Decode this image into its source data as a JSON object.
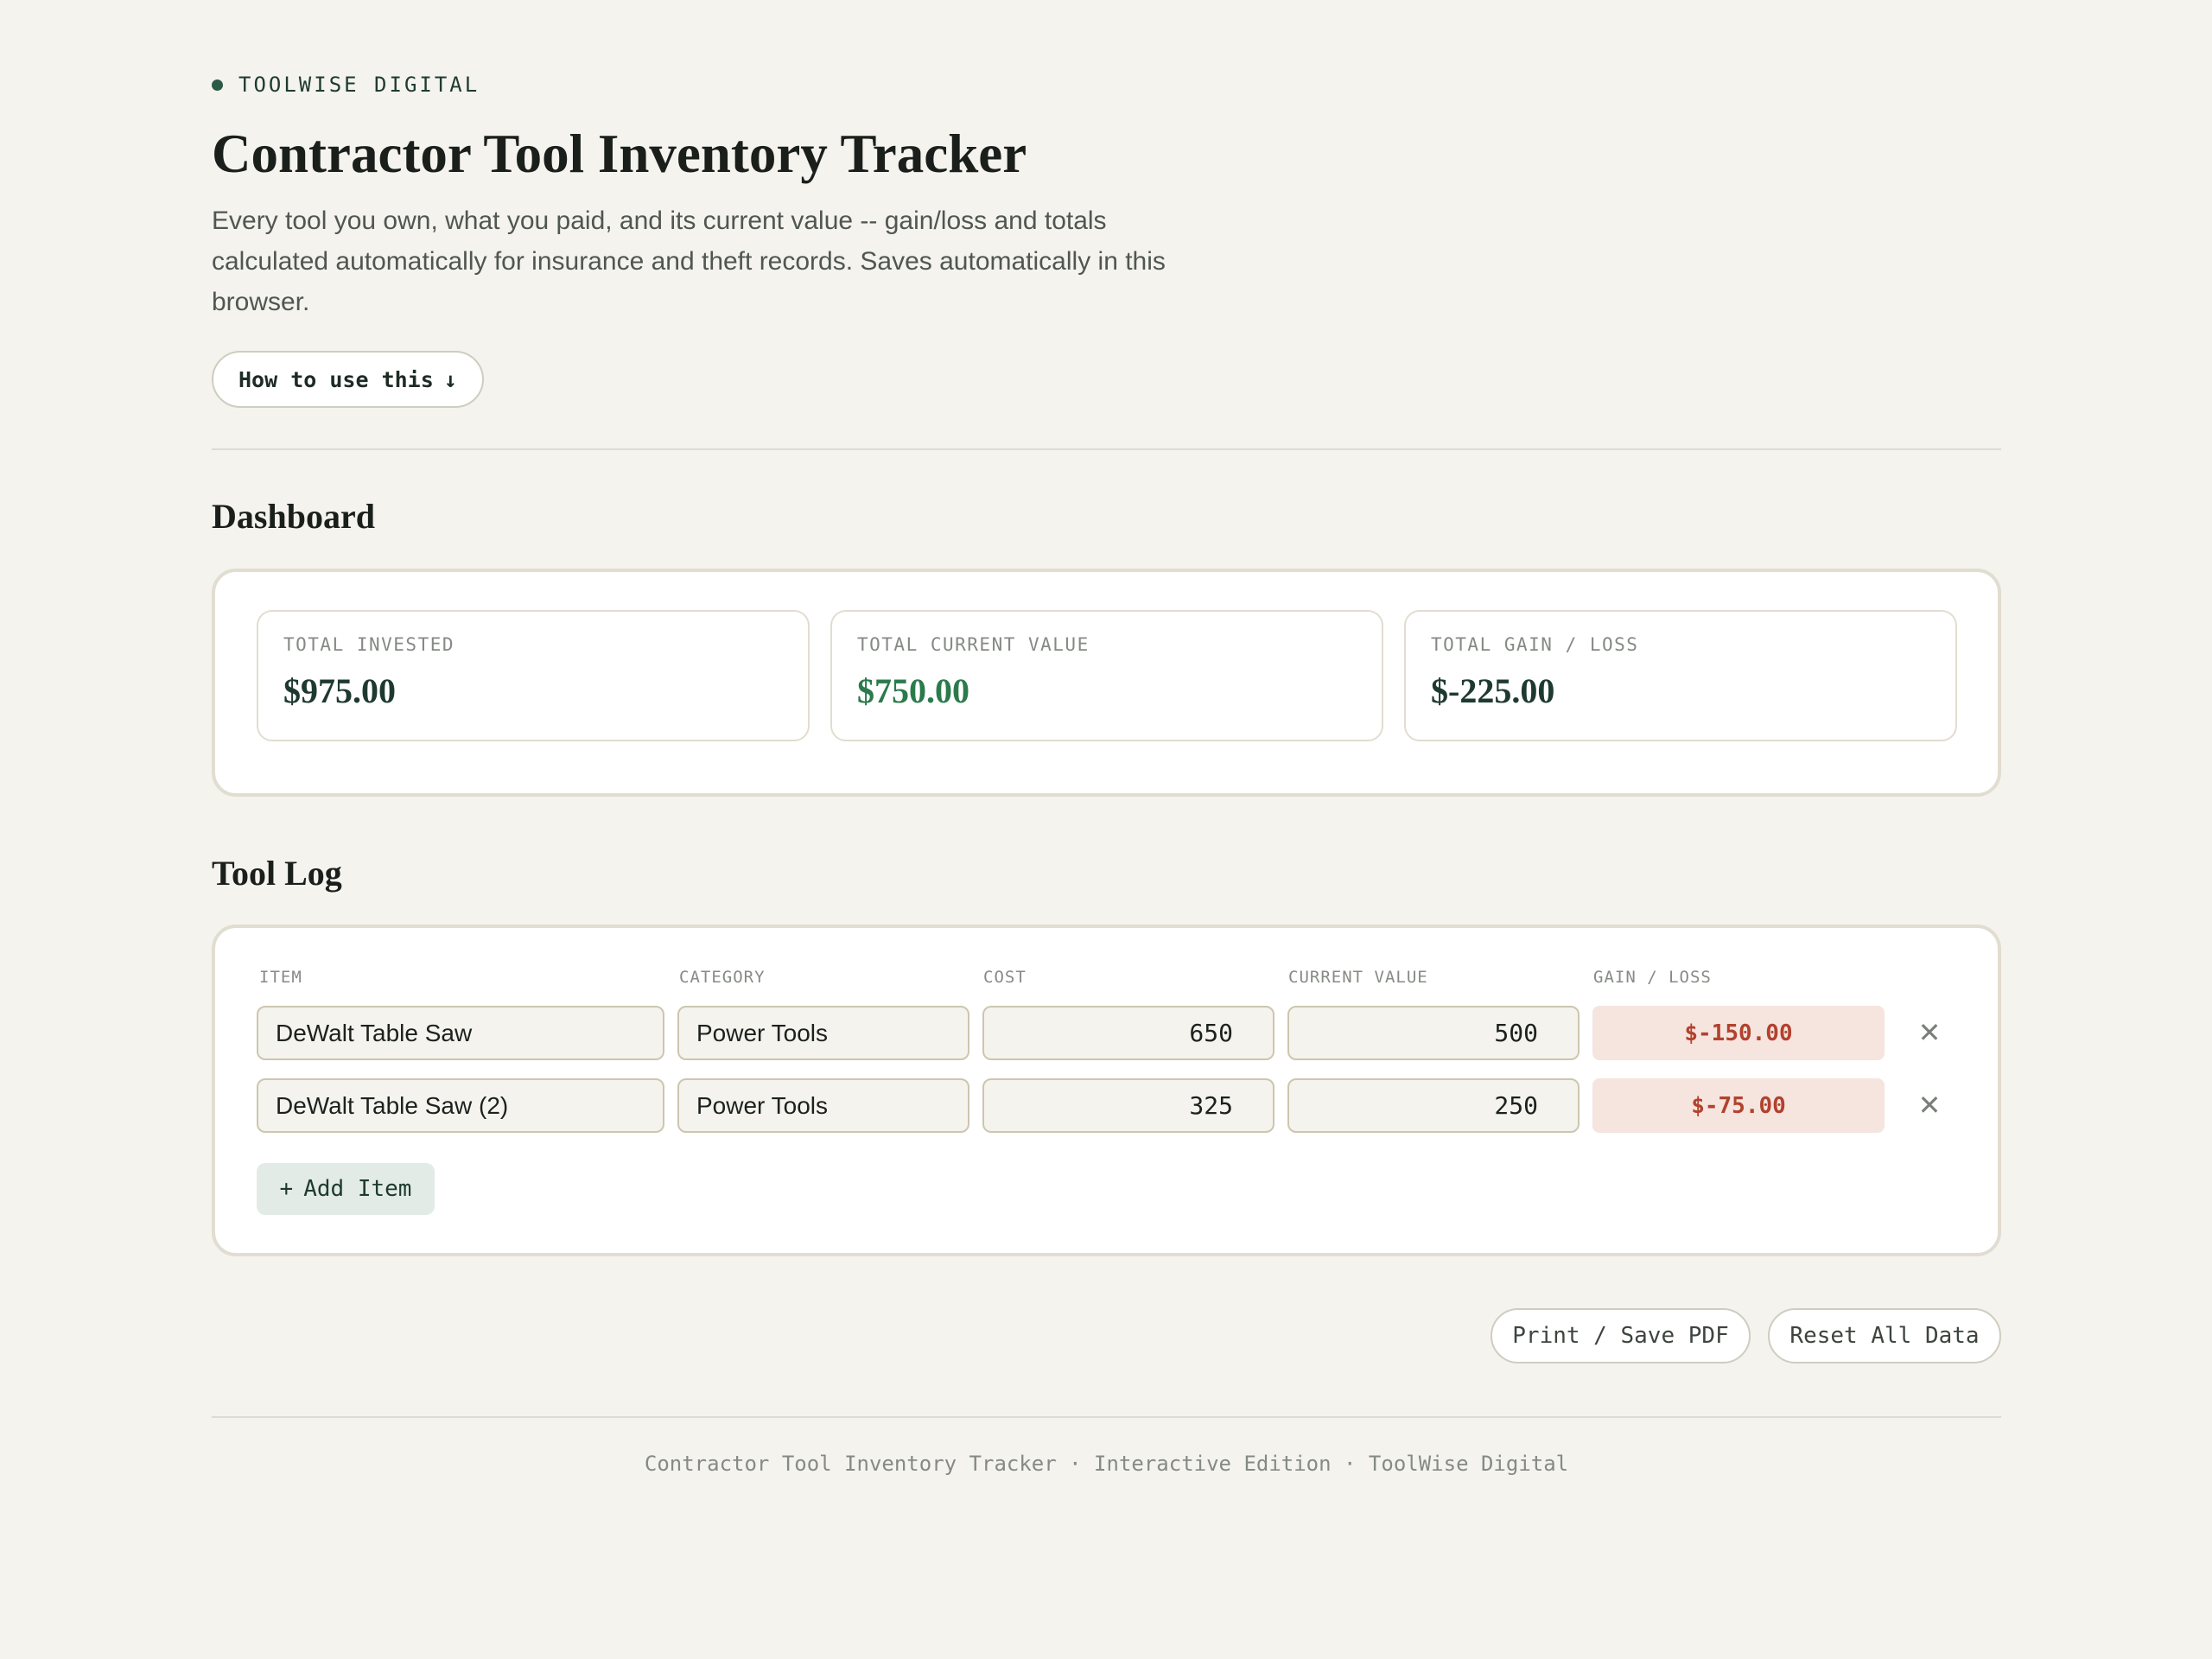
{
  "brand": {
    "name": "TOOLWISE DIGITAL"
  },
  "header": {
    "title": "Contractor Tool Inventory Tracker",
    "intro": "Every tool you own, what you paid, and its current value -- gain/loss and totals calculated automatically for insurance and theft records. Saves automatically in this browser.",
    "howto_label": "How to use this",
    "howto_icon": "↓"
  },
  "dashboard": {
    "heading": "Dashboard",
    "stats": [
      {
        "label": "TOTAL INVESTED",
        "value": "$975.00"
      },
      {
        "label": "TOTAL CURRENT VALUE",
        "value": "$750.00"
      },
      {
        "label": "TOTAL GAIN / LOSS",
        "value": "$-225.00"
      }
    ]
  },
  "toollog": {
    "heading": "Tool Log",
    "columns": [
      "ITEM",
      "CATEGORY",
      "COST",
      "CURRENT VALUE",
      "GAIN / LOSS"
    ],
    "rows": [
      {
        "item": "DeWalt Table Saw",
        "category": "Power Tools",
        "cost": "650",
        "current": "500",
        "gain": "$-150.00"
      },
      {
        "item": "DeWalt Table Saw (2)",
        "category": "Power Tools",
        "cost": "325",
        "current": "250",
        "gain": "$-75.00"
      }
    ],
    "remove_icon": "✕",
    "add_icon": "+",
    "add_label": "Add Item"
  },
  "actions": {
    "print_label": "Print / Save PDF",
    "reset_label": "Reset All Data"
  },
  "footer": {
    "text": "Contractor Tool Inventory Tracker · Interactive Edition · ToolWise Digital"
  },
  "colors": {
    "background": "#f4f3ee",
    "accent": "#2b5a48",
    "positive": "#2b7a4b",
    "negative": "#b1422e",
    "negative_bg": "#f6e4df"
  }
}
